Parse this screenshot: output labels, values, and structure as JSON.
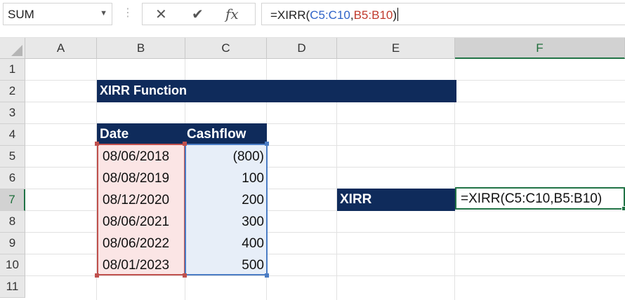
{
  "name_box": {
    "value": "SUM"
  },
  "formula_bar": {
    "parts": [
      {
        "text": "=XIRR("
      },
      {
        "text": "C5:C10"
      },
      {
        "text": ","
      },
      {
        "text": "B5:B10"
      },
      {
        "text": ")"
      }
    ]
  },
  "columns": [
    "A",
    "B",
    "C",
    "D",
    "E",
    "F"
  ],
  "rows": [
    "1",
    "2",
    "3",
    "4",
    "5",
    "6",
    "7",
    "8",
    "9",
    "10",
    "11"
  ],
  "sheet": {
    "title": "XIRR Function",
    "table": {
      "headers": [
        "Date",
        "Cashflow"
      ],
      "rows": [
        {
          "date": "08/06/2018",
          "cashflow": "(800)"
        },
        {
          "date": "08/08/2019",
          "cashflow": "100"
        },
        {
          "date": "08/12/2020",
          "cashflow": "200"
        },
        {
          "date": "08/06/2021",
          "cashflow": "300"
        },
        {
          "date": "08/06/2022",
          "cashflow": "400"
        },
        {
          "date": "08/01/2023",
          "cashflow": "500"
        }
      ]
    },
    "result_label": "XIRR",
    "result_formula": "=XIRR(C5:C10,B5:B10)"
  },
  "colors": {
    "banner": "#0f2b5b",
    "date_range": "#c0504d",
    "cash_range": "#4a7cc4",
    "active_cell": "#217346"
  }
}
